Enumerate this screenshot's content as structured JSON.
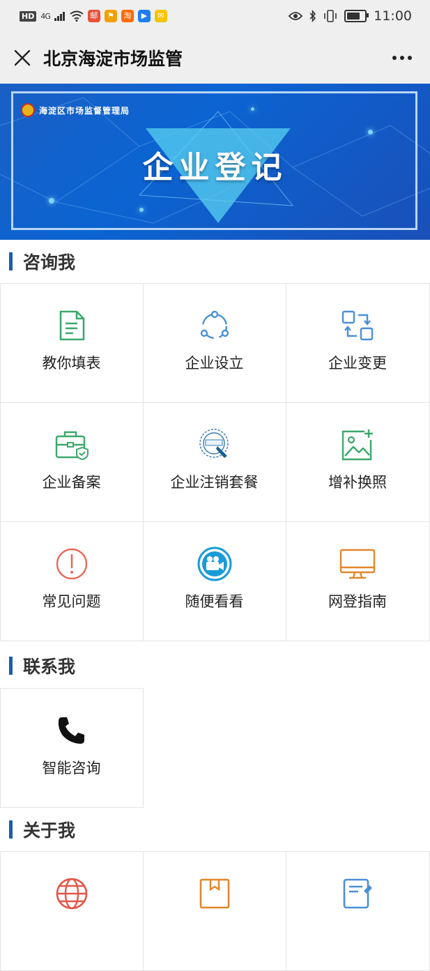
{
  "statusbar": {
    "network": "4G",
    "time": "11:00",
    "hd_label": "HD",
    "app_icons": [
      {
        "name": "mail-app",
        "text": "邮",
        "color": "#e8513a"
      },
      {
        "name": "location-app",
        "text": "⚑",
        "color": "#f0a000"
      },
      {
        "name": "taobao-app",
        "text": "淘",
        "color": "#ff6a00"
      },
      {
        "name": "video-app",
        "text": "▶",
        "color": "#1e7cf2"
      },
      {
        "name": "email-app",
        "text": "✉",
        "color": "#f5c400"
      }
    ]
  },
  "navbar": {
    "title": "北京海淀市场监管",
    "more": "···"
  },
  "banner": {
    "org_name": "海淀区市场监督管理局",
    "title": "企业登记"
  },
  "sections": [
    {
      "title": "咨询我",
      "items": [
        {
          "label": "教你填表",
          "icon": "form-document-icon",
          "color": "#3aa86a"
        },
        {
          "label": "企业设立",
          "icon": "circle-nodes-icon",
          "color": "#4a8fd8"
        },
        {
          "label": "企业变更",
          "icon": "change-swap-icon",
          "color": "#4a8fd8"
        },
        {
          "label": "企业备案",
          "icon": "briefcase-shield-icon",
          "color": "#3aa86a"
        },
        {
          "label": "企业注销套餐",
          "icon": "cancel-stamp-icon",
          "color": "#3a7fb0"
        },
        {
          "label": "增补换照",
          "icon": "photo-add-icon",
          "color": "#3aa86a"
        },
        {
          "label": "常见问题",
          "icon": "exclamation-circle-icon",
          "color": "#e56a5a"
        },
        {
          "label": "随便看看",
          "icon": "video-camera-icon",
          "color": "#1a9bd8"
        },
        {
          "label": "网登指南",
          "icon": "monitor-icon",
          "color": "#e0872a"
        }
      ]
    },
    {
      "title": "联系我",
      "items": [
        {
          "label": "智能咨询",
          "icon": "phone-icon",
          "color": "#111111"
        }
      ]
    },
    {
      "title": "关于我",
      "items": [
        {
          "label": "",
          "icon": "globe-icon",
          "color": "#e0574a"
        },
        {
          "label": "",
          "icon": "box-icon",
          "color": "#e0872a"
        },
        {
          "label": "",
          "icon": "document-edit-icon",
          "color": "#4a8fd8"
        }
      ]
    }
  ]
}
